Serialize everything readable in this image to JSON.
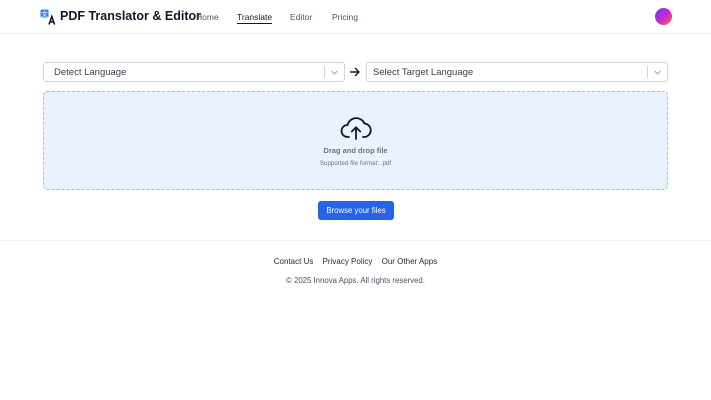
{
  "header": {
    "logo_icon": "translate-icon",
    "app_title": "PDF Translator & Editor",
    "nav": [
      {
        "label": "Home",
        "active": false
      },
      {
        "label": "Translate",
        "active": true
      },
      {
        "label": "Editor",
        "active": false
      },
      {
        "label": "Pricing",
        "active": false
      }
    ],
    "avatar_icon": "user-avatar"
  },
  "translator": {
    "source_language": "Detect Language",
    "target_language": "Select Target Language",
    "swap_icon": "arrow-right-icon",
    "dropzone": {
      "icon": "cloud-upload-icon",
      "title": "Drag and drop file",
      "subtitle": "Supported file format: .pdf"
    },
    "browse_label": "Browse your files"
  },
  "footer": {
    "links": [
      "Contact Us",
      "Privacy Policy",
      "Our Other Apps"
    ],
    "copyright": "© 2025 Innova Apps. All rights reserved."
  },
  "colors": {
    "accent": "#2563eb",
    "dropzone_bg": "#eaf2ff",
    "dropzone_border": "#93c5fd"
  }
}
